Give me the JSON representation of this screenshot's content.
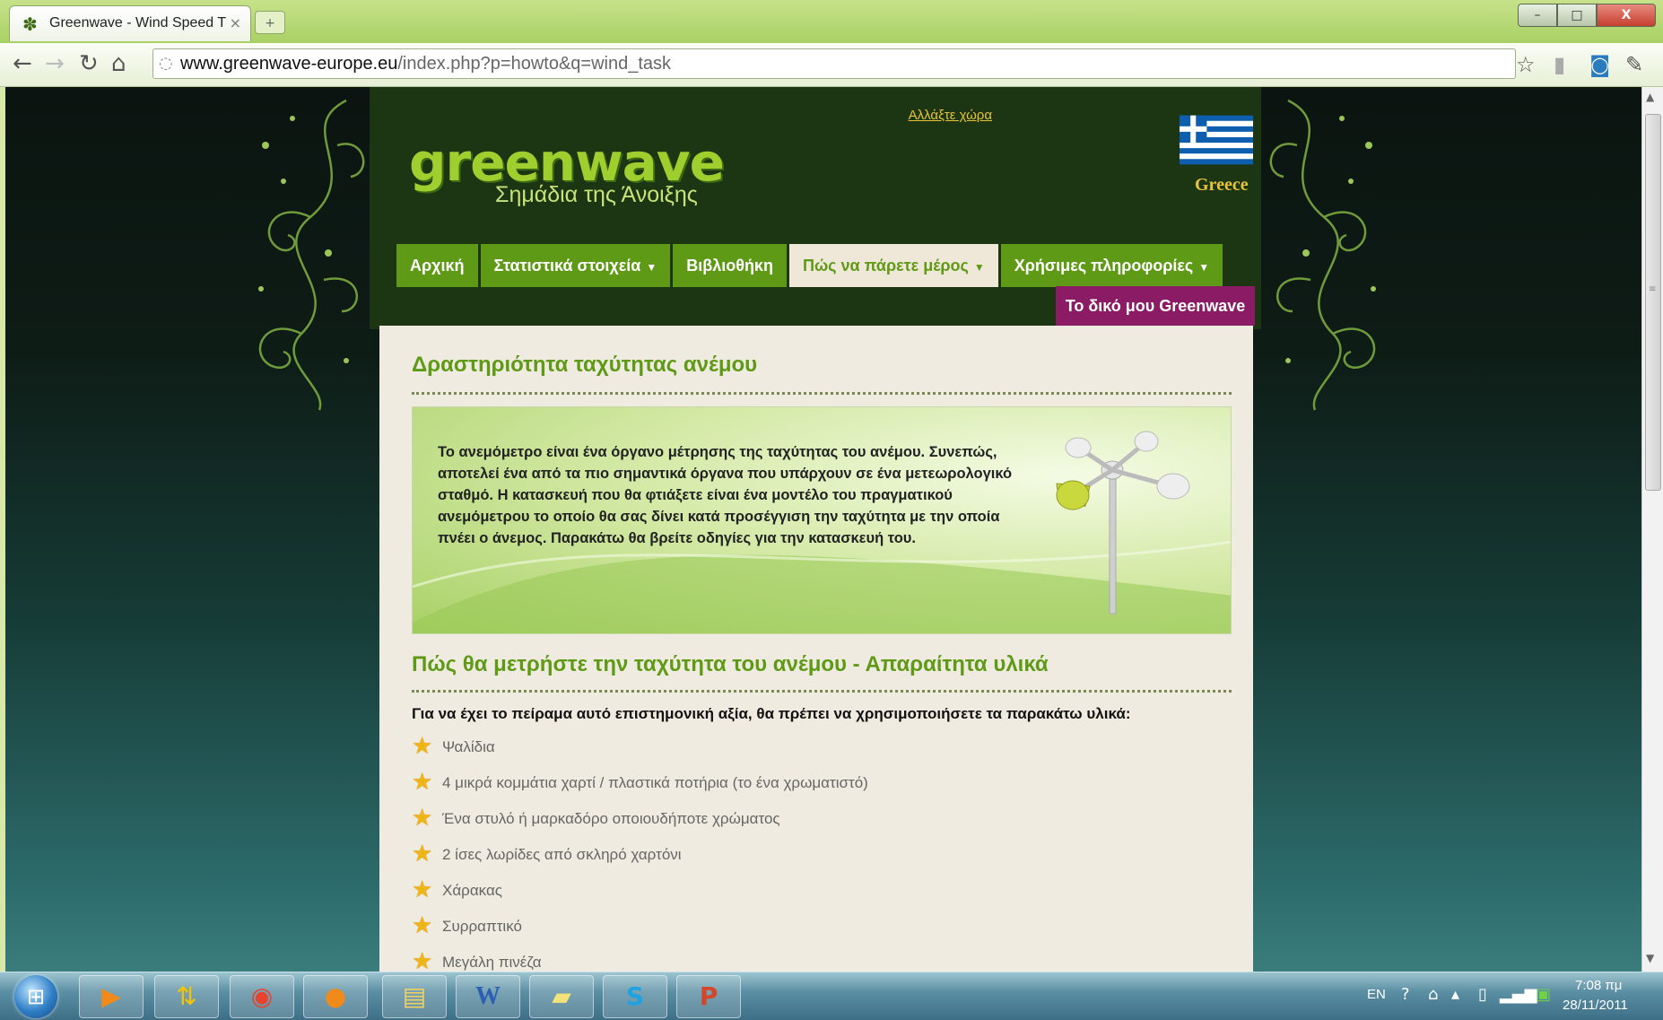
{
  "browser": {
    "tab_title": "Greenwave - Wind Speed T",
    "tab_close": "×",
    "new_tab": "+",
    "url_host": "www.greenwave-europe.eu",
    "url_path": "/index.php?p=howto&q=wind_task",
    "window_buttons": {
      "minimize": "–",
      "maximize": "□",
      "close": "X"
    }
  },
  "header": {
    "logo": "greenwave",
    "tagline": "Σημάδια της Άνοιξης",
    "change_country": "Αλλάξτε χώρα",
    "country": "Greece"
  },
  "nav": {
    "items": [
      {
        "label": "Αρχική",
        "caret": ""
      },
      {
        "label": "Στατιστικά στοιχεία",
        "caret": "▼"
      },
      {
        "label": "Βιβλιοθήκη",
        "caret": ""
      },
      {
        "label": "Πώς να πάρετε μέρος",
        "caret": "▼",
        "active": true
      },
      {
        "label": "Χρήσιμες πληροφορίες",
        "caret": "▼"
      }
    ],
    "my_greenwave": "Το δικό μου Greenwave"
  },
  "content": {
    "title": "Δραστηριότητα ταχύτητας ανέμου",
    "intro": "Το ανεμόμετρο είναι ένα όργανο μέτρησης της ταχύτητας του ανέμου. Συνεπώς, αποτελεί ένα από τα πιο σημαντικά όργανα που υπάρχουν σε ένα μετεωρολογικό σταθμό. Η κατασκευή που θα φτιάξετε είναι ένα μοντέλο του πραγματικού ανεμόμετρου το οποίο θα σας δίνει κατά προσέγγιση την ταχύτητα με την οποία πνέει ο άνεμος. Παρακάτω θα βρείτε οδηγίες για την κατασκευή του.",
    "subtitle": "Πώς θα μετρήστε την ταχύτητα του ανέμου - Απαραίτητα υλικά",
    "lead": "Για να έχει το πείραμα αυτό επιστημονική αξία, θα πρέπει να χρησιμοποιήσετε τα παρακάτω υλικά:",
    "materials": [
      "Ψαλίδια",
      "4 μικρά κομμάτια χαρτί / πλαστικά ποτήρια (το ένα χρωματιστό)",
      "Ένα στυλό ή μαρκαδόρο οποιουδήποτε χρώματος",
      "2 ίσες λωρίδες από σκληρό χαρτόνι",
      "Χάρακας",
      "Συρραπτικό",
      "Μεγάλη πινέζα"
    ]
  },
  "taskbar": {
    "language": "EN",
    "time": "7:08 πμ",
    "date": "28/11/2011"
  },
  "colors": {
    "brand_green": "#5f9a16",
    "my_greenwave_bg": "#8a1b64",
    "header_bg": "#1c3614",
    "content_bg": "#f0ebe0"
  }
}
